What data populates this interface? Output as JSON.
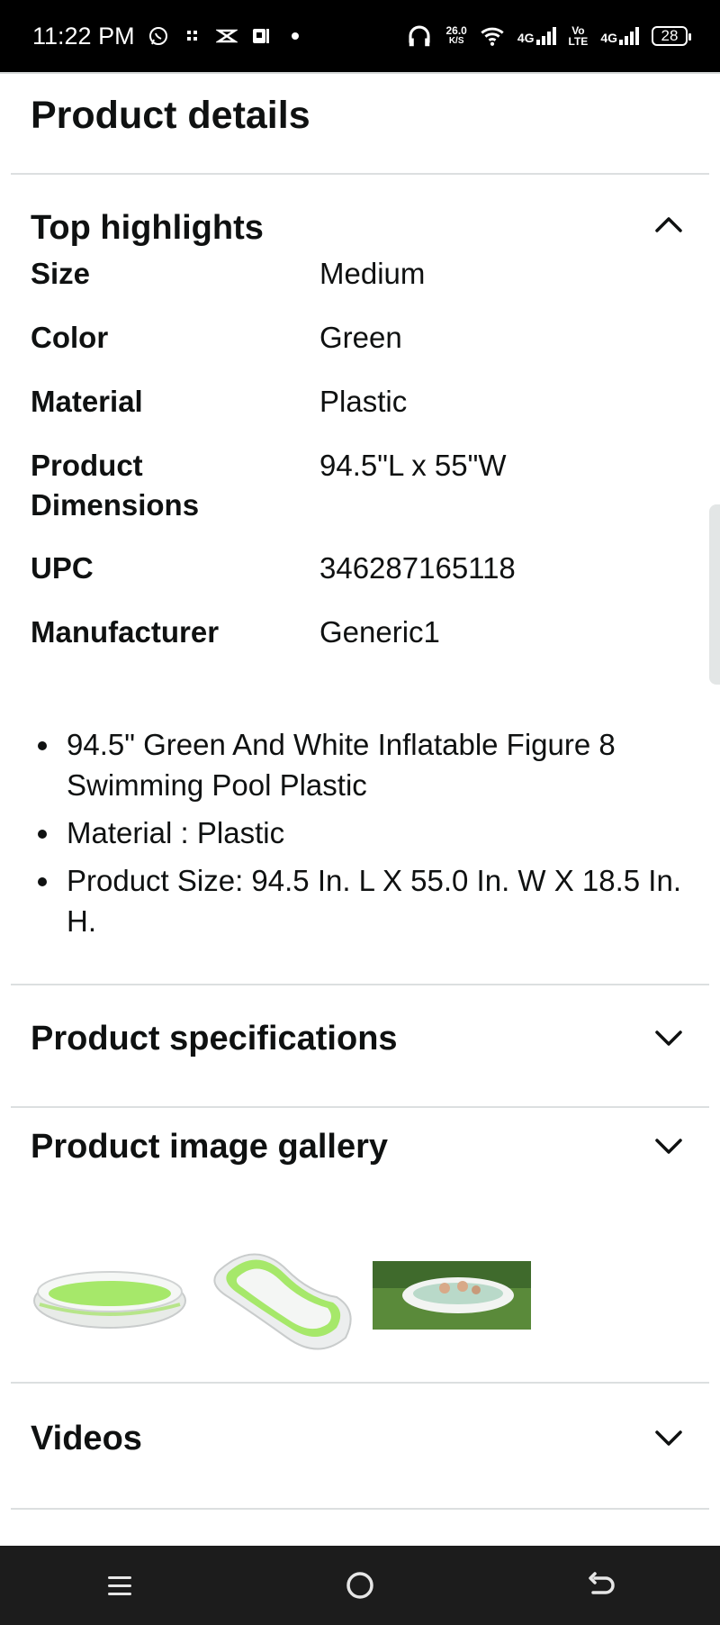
{
  "status_bar": {
    "time": "11:22 PM",
    "net_speed_value": "26.0",
    "net_speed_unit": "K/S",
    "network1": "4G",
    "network2_top": "Vo",
    "network2_bottom": "LTE",
    "network3": "4G",
    "battery": "28"
  },
  "page": {
    "title": "Product details"
  },
  "top_highlights": {
    "heading": "Top highlights",
    "expanded": true,
    "rows": [
      {
        "key": "Size",
        "value": "Medium"
      },
      {
        "key": "Color",
        "value": "Green"
      },
      {
        "key": "Material",
        "value": "Plastic"
      },
      {
        "key_line1": "Product",
        "key_line2": "Dimensions",
        "value": "94.5\"L x 55\"W"
      },
      {
        "key": "UPC",
        "value": "346287165118"
      },
      {
        "key": "Manufacturer",
        "value": "Generic1"
      }
    ],
    "bullets": [
      "94.5\" Green And White Inflatable Figure 8 Swimming Pool Plastic",
      "Material : Plastic",
      "Product Size: 94.5 In. L X 55.0 In. W X 18.5 In. H."
    ]
  },
  "product_specifications": {
    "heading": "Product specifications",
    "expanded": false
  },
  "product_image_gallery": {
    "heading": "Product image gallery",
    "expanded": false,
    "images": [
      {
        "icon": "pool-side-view-thumbnail"
      },
      {
        "icon": "pool-angled-view-thumbnail"
      },
      {
        "icon": "pool-on-grass-photo-thumbnail"
      }
    ]
  },
  "videos": {
    "heading": "Videos",
    "expanded": false
  },
  "nav_bar": {
    "buttons": [
      "menu-icon",
      "home-icon",
      "back-icon"
    ]
  },
  "colors": {
    "accent_green": "#9ee05a",
    "text": "#0f1111",
    "divider": "#dcdfe0"
  }
}
